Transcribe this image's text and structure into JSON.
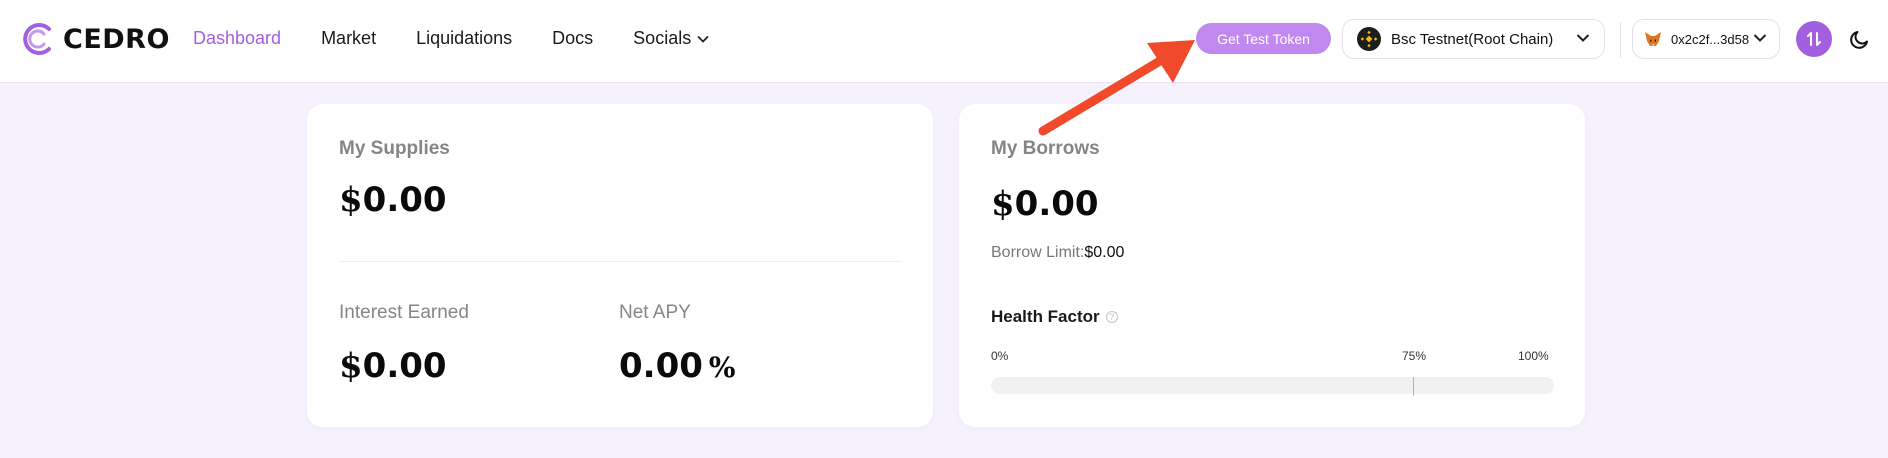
{
  "navbar": {
    "logo_text": "CEDRO",
    "links": [
      {
        "label": "Dashboard",
        "active": true
      },
      {
        "label": "Market"
      },
      {
        "label": "Liquidations"
      },
      {
        "label": "Docs"
      },
      {
        "label": "Socials",
        "dropdown": true
      }
    ],
    "test_token_button": "Get Test Token",
    "network": {
      "label": "Bsc Testnet(Root Chain)",
      "icon": "bnb-icon"
    },
    "wallet": {
      "address": "0x2c2f...3d58",
      "icon": "metamask-fox-icon"
    },
    "swap_icon": "swap-arrows-icon",
    "theme_icon": "moon-icon"
  },
  "supplies": {
    "title": "My Supplies",
    "currency": "$",
    "value": "0.00",
    "interest_label": "Interest Earned",
    "interest_currency": "$",
    "interest_value": "0.00",
    "apy_label": "Net APY",
    "apy_value": "0.00",
    "apy_unit": "%"
  },
  "borrows": {
    "title": "My Borrows",
    "currency": "$",
    "value": "0.00",
    "borrow_limit_label": "Borrow Limit:",
    "borrow_limit_value": "$0.00",
    "health_factor_label": "Health Factor",
    "health_ticks": [
      "0%",
      "75%",
      "100%"
    ],
    "health_fill_fraction": 0
  },
  "colors": {
    "accent": "#a160e0",
    "test_token_bg": "#c189ef",
    "page_bg": "#f6f2fd",
    "annotation_arrow": "#f04a2a"
  }
}
